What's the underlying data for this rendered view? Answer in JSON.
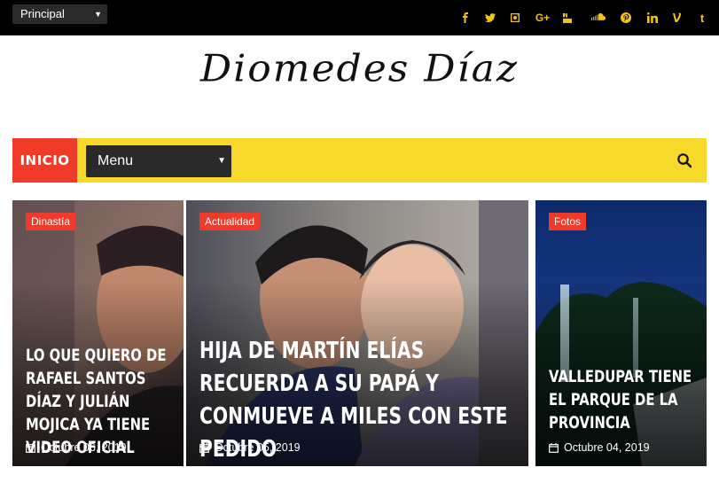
{
  "topbar": {
    "select_value": "Principal",
    "social_icons": [
      "facebook-icon",
      "twitter-icon",
      "instagram-icon",
      "google-plus-icon",
      "youtube-icon",
      "soundcloud-icon",
      "pinterest-icon",
      "linkedin-icon",
      "vine-icon",
      "tumblr-icon"
    ],
    "icon_color": "#f4c21b"
  },
  "logo": {
    "text": "Diomedes Díaz"
  },
  "nav": {
    "home_label": "INICIO",
    "menu_value": "Menu",
    "accent": "#f03a2a",
    "bar_color": "#f6d92b"
  },
  "cards": [
    {
      "category": "Dinastía",
      "title": "LO QUE QUIERO DE RAFAEL SANTOS DÍAZ Y JULIÁN MOJICA YA TIENE VIDEO OFICIAL",
      "date": "Octubre 06, 2019"
    },
    {
      "category": "Actualidad",
      "title": "HIJA DE MARTÍN ELÍAS RECUERDA A SU PAPÁ Y CONMUEVE A MILES CON ESTE PEDIDO",
      "date": "Octubre 05, 2019"
    },
    {
      "category": "Fotos",
      "title": "VALLEDUPAR TIENE EL PARQUE DE LA PROVINCIA",
      "date": "Octubre 04, 2019"
    }
  ]
}
